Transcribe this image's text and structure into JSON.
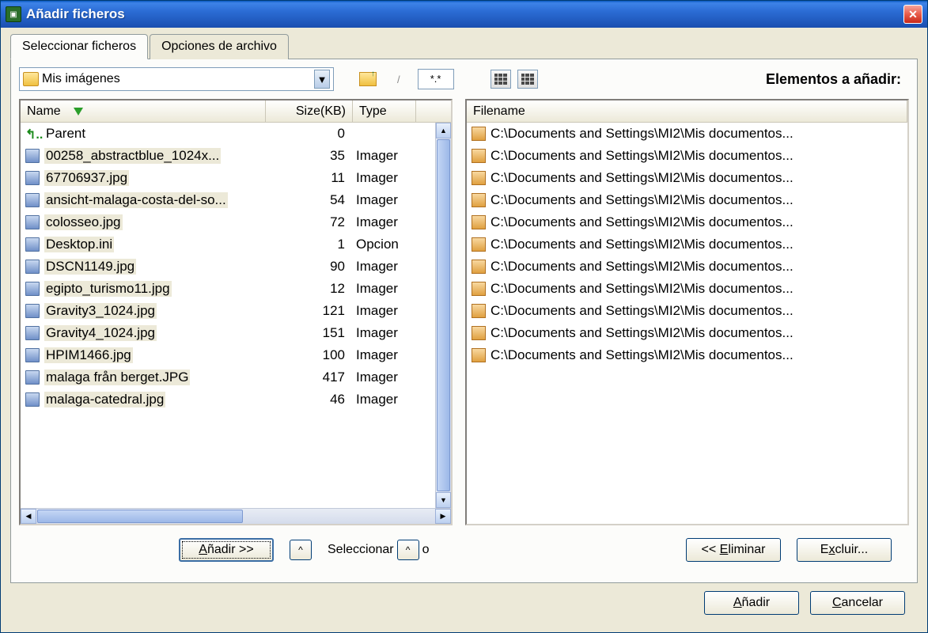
{
  "window": {
    "title": "Añadir ficheros"
  },
  "tabs": {
    "select_files": "Seleccionar ficheros",
    "archive_options": "Opciones de archivo"
  },
  "toolbar": {
    "current_folder": "Mis imágenes",
    "filter_pattern": "*.*",
    "elements_to_add_label": "Elementos a añadir:"
  },
  "file_list": {
    "columns": {
      "name": "Name",
      "size": "Size(KB)",
      "type": "Type"
    },
    "rows": [
      {
        "icon": "parent",
        "name": "Parent",
        "size": "0",
        "type": ""
      },
      {
        "icon": "img",
        "name": "00258_abstractblue_1024x...",
        "size": "35",
        "type": "Imager"
      },
      {
        "icon": "img",
        "name": "67706937.jpg",
        "size": "11",
        "type": "Imager"
      },
      {
        "icon": "img",
        "name": "ansicht-malaga-costa-del-so...",
        "size": "54",
        "type": "Imager"
      },
      {
        "icon": "img",
        "name": "colosseo.jpg",
        "size": "72",
        "type": "Imager"
      },
      {
        "icon": "ini",
        "name": "Desktop.ini",
        "size": "1",
        "type": "Opcion"
      },
      {
        "icon": "img",
        "name": "DSCN1149.jpg",
        "size": "90",
        "type": "Imager"
      },
      {
        "icon": "img",
        "name": "egipto_turismo11.jpg",
        "size": "12",
        "type": "Imager"
      },
      {
        "icon": "img",
        "name": "Gravity3_1024.jpg",
        "size": "121",
        "type": "Imager"
      },
      {
        "icon": "img",
        "name": "Gravity4_1024.jpg",
        "size": "151",
        "type": "Imager"
      },
      {
        "icon": "img",
        "name": "HPIM1466.jpg",
        "size": "100",
        "type": "Imager"
      },
      {
        "icon": "img",
        "name": "malaga från berget.JPG",
        "size": "417",
        "type": "Imager"
      },
      {
        "icon": "img",
        "name": "malaga-catedral.jpg",
        "size": "46",
        "type": "Imager"
      }
    ]
  },
  "selected_list": {
    "column": "Filename",
    "rows": [
      "C:\\Documents and Settings\\MI2\\Mis documentos...",
      "C:\\Documents and Settings\\MI2\\Mis documentos...",
      "C:\\Documents and Settings\\MI2\\Mis documentos...",
      "C:\\Documents and Settings\\MI2\\Mis documentos...",
      "C:\\Documents and Settings\\MI2\\Mis documentos...",
      "C:\\Documents and Settings\\MI2\\Mis documentos...",
      "C:\\Documents and Settings\\MI2\\Mis documentos...",
      "C:\\Documents and Settings\\MI2\\Mis documentos...",
      "C:\\Documents and Settings\\MI2\\Mis documentos...",
      "C:\\Documents and Settings\\MI2\\Mis documentos...",
      "C:\\Documents and Settings\\MI2\\Mis documentos..."
    ]
  },
  "buttons": {
    "add_to_list": "Añadir >>",
    "select_all_prefix": "Seleccionar",
    "select_all_suffix": "o",
    "remove": "<< Eliminar",
    "exclude": "Excluir...",
    "add": "Añadir",
    "cancel": "Cancelar"
  }
}
